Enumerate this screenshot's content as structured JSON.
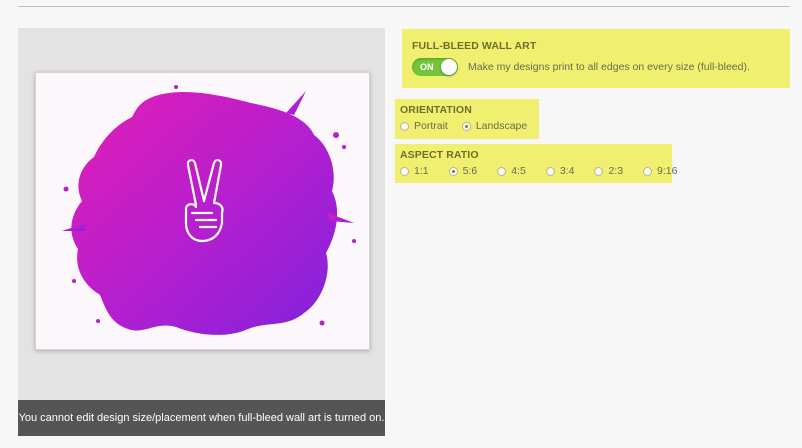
{
  "preview": {
    "notice": "You cannot edit design size/placement when full-bleed wall art is turned on.",
    "artwork_icon": "peace-hand-icon"
  },
  "fullbleed": {
    "title": "FULL-BLEED WALL ART",
    "toggle_label": "ON",
    "toggle_on": true,
    "description": "Make my designs print to all edges on every size (full-bleed)."
  },
  "orientation": {
    "title": "ORIENTATION",
    "options": [
      {
        "label": "Portrait",
        "selected": false
      },
      {
        "label": "Landscape",
        "selected": true
      }
    ]
  },
  "aspect_ratio": {
    "title": "ASPECT RATIO",
    "options": [
      {
        "label": "1:1",
        "selected": false
      },
      {
        "label": "5:6",
        "selected": true
      },
      {
        "label": "4:5",
        "selected": false
      },
      {
        "label": "3:4",
        "selected": false
      },
      {
        "label": "2:3",
        "selected": false
      },
      {
        "label": "9:16",
        "selected": false
      }
    ]
  },
  "colors": {
    "highlight": "#f1ef6f",
    "toggle_on": "#74c33a",
    "notice_bg": "#555555",
    "splash_from": "#e41db6",
    "splash_to": "#8a22d8"
  }
}
